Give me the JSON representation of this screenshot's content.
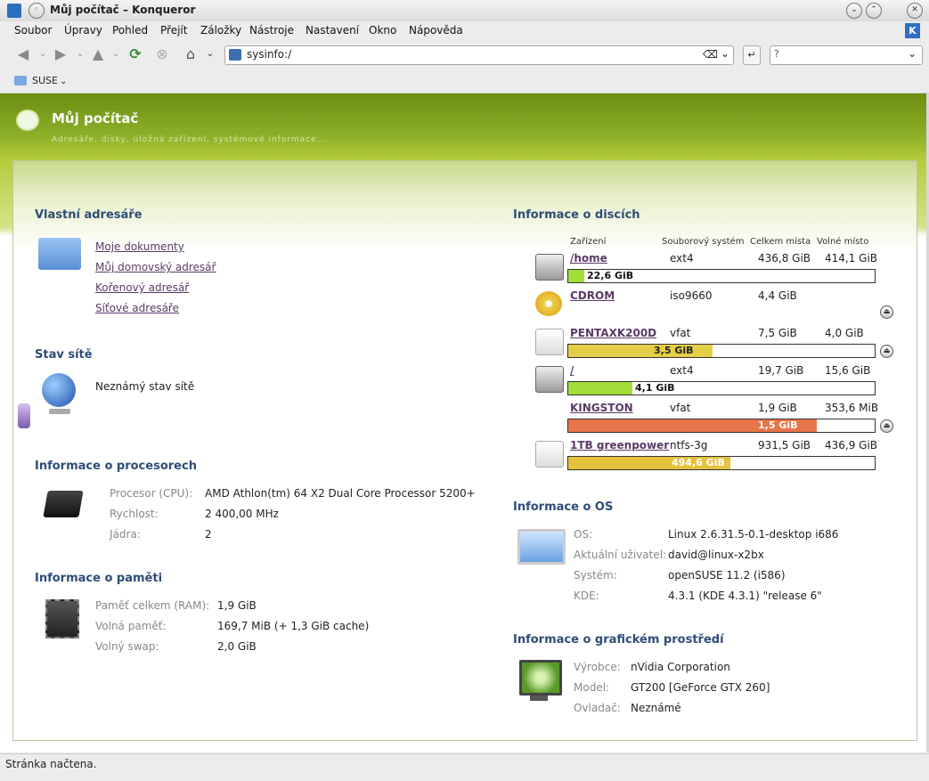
{
  "window": {
    "title": "Můj počítač – Konqueror",
    "menu": [
      "Soubor",
      "Úpravy",
      "Pohled",
      "Přejít",
      "Záložky",
      "Nástroje",
      "Nastavení",
      "Okno",
      "Nápověda"
    ],
    "url": "sysinfo:/",
    "bookmark": "SUSE",
    "status": "Stránka načtena."
  },
  "header": {
    "title": "Můj počítač",
    "subtitle": "Adresáře, disky, úložná zařízení, systémové informace..."
  },
  "folders": {
    "title": "Vlastní adresáře",
    "links": [
      "Moje dokumenty",
      "Můj domovský adresář",
      "Kořenový adresář",
      "Síťové adresáře"
    ]
  },
  "network": {
    "title": "Stav sítě",
    "status": "Neznámý stav sítě"
  },
  "cpu": {
    "title": "Informace o procesorech",
    "rows": [
      {
        "label": "Procesor (CPU):",
        "value": "AMD Athlon(tm) 64 X2 Dual Core Processor 5200+"
      },
      {
        "label": "Rychlost:",
        "value": "2 400,00 MHz"
      },
      {
        "label": "Jádra:",
        "value": "2"
      }
    ]
  },
  "memory": {
    "title": "Informace o paměti",
    "rows": [
      {
        "label": "Paměť celkem (RAM):",
        "value": "1,9 GiB"
      },
      {
        "label": "Volná paměť:",
        "value": "169,7 MiB (+ 1,3 GiB cache)"
      },
      {
        "label": "Volný swap:",
        "value": "2,0 GiB"
      }
    ]
  },
  "disks": {
    "title": "Informace o discích",
    "headers": [
      "Zařízení",
      "Souborový systém",
      "Celkem místa",
      "Volné místo"
    ],
    "items": [
      {
        "name": "/home",
        "fs": "ext4",
        "total": "436,8 GiB",
        "free": "414,1 GiB",
        "used_label": "22,6 GiB",
        "used_fraction": 0.052,
        "bar_color": "#a3dd3a",
        "icon": "hdd-icon",
        "eject": false
      },
      {
        "name": "CDROM",
        "fs": "iso9660",
        "total": "4,4 GiB",
        "free": "",
        "used_label": "",
        "used_fraction": null,
        "bar_color": "",
        "icon": "cdrom-icon",
        "eject": true
      },
      {
        "name": "PENTAXK200D",
        "fs": "vfat",
        "total": "7,5 GiB",
        "free": "4,0 GiB",
        "used_label": "3,5 GiB",
        "used_fraction": 0.47,
        "bar_color": "#e5cf47",
        "icon": "usb-drive-icon",
        "eject": true
      },
      {
        "name": "/",
        "fs": "ext4",
        "total": "19,7 GiB",
        "free": "15,6 GiB",
        "used_label": "4,1 GiB",
        "used_fraction": 0.21,
        "bar_color": "#a3dd3a",
        "icon": "hdd-icon",
        "eject": false
      },
      {
        "name": "KINGSTON",
        "fs": "vfat",
        "total": "1,9 GiB",
        "free": "353,6 MiB",
        "used_label": "1,5 GiB",
        "used_fraction": 0.81,
        "bar_color": "#e8744a",
        "icon": "usb-stick-icon",
        "eject": true
      },
      {
        "name": "1TB greenpower",
        "fs": "ntfs-3g",
        "total": "931,5 GiB",
        "free": "436,9 GiB",
        "used_label": "494,6 GiB",
        "used_fraction": 0.53,
        "bar_color": "#e5c23e",
        "icon": "usb-drive-icon",
        "eject": false
      }
    ]
  },
  "os": {
    "title": "Informace o OS",
    "rows": [
      {
        "label": "OS:",
        "value": "Linux 2.6.31.5-0.1-desktop i686"
      },
      {
        "label": "Aktuální uživatel:",
        "value": "david@linux-x2bx"
      },
      {
        "label": "Systém:",
        "value": "openSUSE 11.2 (i586)"
      },
      {
        "label": "KDE:",
        "value": "4.3.1 (KDE 4.3.1) \"release 6\""
      }
    ]
  },
  "graphics": {
    "title": "Informace o grafickém prostředí",
    "rows": [
      {
        "label": "Výrobce:",
        "value": "nVidia Corporation"
      },
      {
        "label": "Model:",
        "value": "GT200 [GeForce GTX 260]"
      },
      {
        "label": "Ovladač:",
        "value": "Neznámé"
      }
    ]
  }
}
